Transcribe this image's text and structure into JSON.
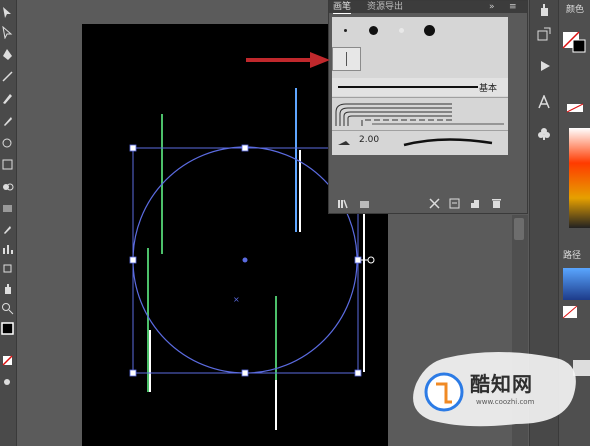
{
  "app": "Adobe Illustrator",
  "brush_panel": {
    "tabs": [
      "画笔",
      "资源导出"
    ],
    "collapse_glyph": "»",
    "menu_glyph": "≡",
    "basic_label": "基本",
    "size_value": "2.00"
  },
  "right_panel": {
    "top_label": "颜色",
    "path_label": "路径"
  },
  "watermark": {
    "name": "酷知网",
    "url": "www.coozhi.com"
  },
  "colors": {
    "artboard": "#000000",
    "selection": "#5b6be0",
    "arrow": "#c0282c",
    "green_line": "#4cc06a"
  },
  "icons": [
    "select-icon",
    "direct-select-icon",
    "pen-icon",
    "type-icon",
    "line-icon",
    "brush-icon",
    "pencil-icon",
    "eraser-icon",
    "rotate-icon",
    "scale-icon",
    "shape-builder-icon",
    "gradient-icon",
    "eyedropper-icon",
    "blend-icon",
    "graph-icon",
    "artboard-icon",
    "hand-icon",
    "zoom-icon",
    "fill-stroke-icon"
  ]
}
